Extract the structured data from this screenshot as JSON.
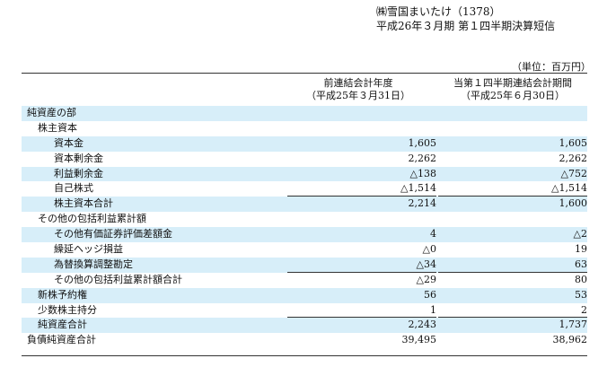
{
  "header": {
    "company_line": "㈱雪国まいたけ（1378）",
    "report_line": "平成26年３月期 第１四半期決算短信"
  },
  "unit": "（単位：百万円）",
  "columns": {
    "prev_line1": "前連結会計年度",
    "prev_line2": "（平成25年３月31日）",
    "curr_line1": "当第１四半期連結会計期間",
    "curr_line2": "（平成25年６月30日）"
  },
  "rows": [
    {
      "label": "純資産の部",
      "indent": 0,
      "prev": "",
      "curr": "",
      "shade": true,
      "ul": false
    },
    {
      "label": "株主資本",
      "indent": 1,
      "prev": "",
      "curr": "",
      "shade": false,
      "ul": false
    },
    {
      "label": "資本金",
      "indent": 2,
      "prev": "1,605",
      "curr": "1,605",
      "shade": true,
      "ul": false
    },
    {
      "label": "資本剰余金",
      "indent": 2,
      "prev": "2,262",
      "curr": "2,262",
      "shade": false,
      "ul": false
    },
    {
      "label": "利益剰余金",
      "indent": 2,
      "prev": "△138",
      "curr": "△752",
      "shade": true,
      "ul": false
    },
    {
      "label": "自己株式",
      "indent": 2,
      "prev": "△1,514",
      "curr": "△1,514",
      "shade": false,
      "ul": true
    },
    {
      "label": "株主資本合計",
      "indent": 2,
      "prev": "2,214",
      "curr": "1,600",
      "shade": true,
      "ul": false
    },
    {
      "label": "その他の包括利益累計額",
      "indent": 1,
      "prev": "",
      "curr": "",
      "shade": false,
      "ul": false
    },
    {
      "label": "その他有価証券評価差額金",
      "indent": 2,
      "prev": "4",
      "curr": "△2",
      "shade": true,
      "ul": false
    },
    {
      "label": "繰延ヘッジ損益",
      "indent": 2,
      "prev": "△0",
      "curr": "19",
      "shade": false,
      "ul": false
    },
    {
      "label": "為替換算調整勘定",
      "indent": 2,
      "prev": "△34",
      "curr": "63",
      "shade": true,
      "ul": true
    },
    {
      "label": "その他の包括利益累計額合計",
      "indent": 2,
      "prev": "△29",
      "curr": "80",
      "shade": false,
      "ul": false
    },
    {
      "label": "新株予約権",
      "indent": 1,
      "prev": "56",
      "curr": "53",
      "shade": true,
      "ul": false
    },
    {
      "label": "少数株主持分",
      "indent": 1,
      "prev": "1",
      "curr": "2",
      "shade": false,
      "ul": true
    },
    {
      "label": "純資産合計",
      "indent": 1,
      "prev": "2,243",
      "curr": "1,737",
      "shade": true,
      "ul": false
    },
    {
      "label": "負債純資産合計",
      "indent": 0,
      "prev": "39,495",
      "curr": "38,962",
      "shade": false,
      "ul": false
    }
  ]
}
